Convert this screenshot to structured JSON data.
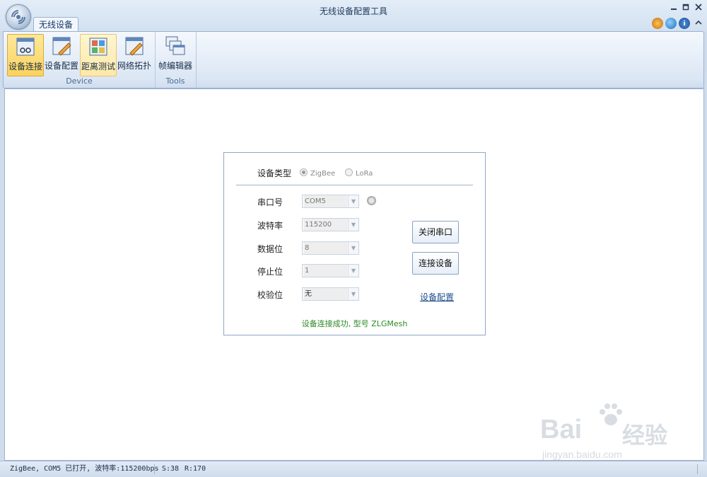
{
  "window": {
    "title": "无线设备配置工具",
    "ribbon_tab": "无线设备"
  },
  "ribbon": {
    "groups": [
      {
        "label": "Device",
        "buttons": [
          "设备连接",
          "设备配置",
          "距离测试",
          "网络拓扑"
        ]
      },
      {
        "label": "Tools",
        "buttons": [
          "帧编辑器"
        ]
      }
    ],
    "active_button": "设备连接"
  },
  "form": {
    "device_type_label": "设备类型",
    "radio_zigbee": "ZigBee",
    "radio_lora": "LoRa",
    "selected_type": "ZigBee",
    "port_label": "串口号",
    "port_value": "COM5",
    "baud_label": "波特率",
    "baud_value": "115200",
    "databits_label": "数据位",
    "databits_value": "8",
    "stopbits_label": "停止位",
    "stopbits_value": "1",
    "parity_label": "校验位",
    "parity_value": "无",
    "close_port_button": "关闭串口",
    "connect_button": "连接设备",
    "config_link": "设备配置",
    "success_message": "设备连接成功, 型号 ZLGMesh"
  },
  "statusbar": {
    "port_status": "ZigBee, COM5 已打开, 波特率:115200bps",
    "sent": "S:38",
    "received": "R:170"
  },
  "watermark": {
    "text": "Bai",
    "text_cn": "经验",
    "url": "jingyan.baidu.com"
  },
  "colors": {
    "accent": "#fbd25c",
    "success": "#2c8a23",
    "link": "#1f4e8c",
    "frame": "#9ab2d1"
  }
}
